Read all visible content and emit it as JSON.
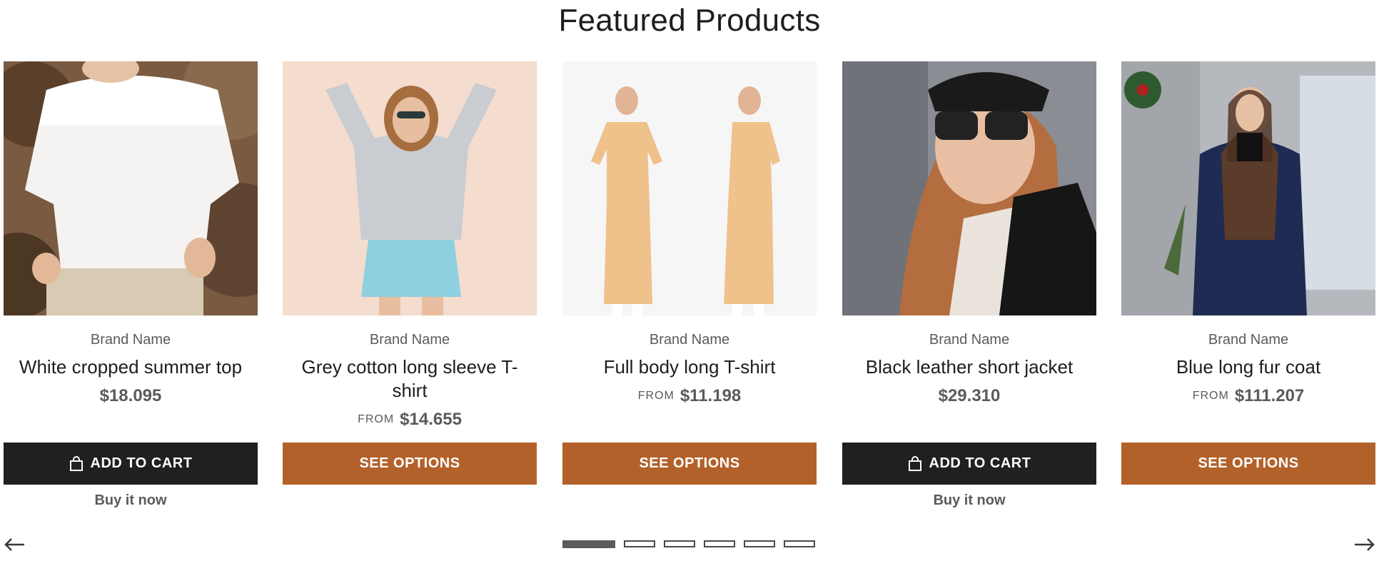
{
  "section": {
    "title": "Featured Products"
  },
  "products": [
    {
      "brand": "Brand Name",
      "name": "White cropped summer top",
      "from": "",
      "price": "$18.095",
      "button": "ADD TO CART",
      "buy_now": "Buy it now"
    },
    {
      "brand": "Brand Name",
      "name": "Grey cotton long sleeve T-shirt",
      "from": "FROM",
      "price": "$14.655",
      "button": "SEE OPTIONS",
      "buy_now": ""
    },
    {
      "brand": "Brand Name",
      "name": "Full body long T-shirt",
      "from": "FROM",
      "price": "$11.198",
      "button": "SEE OPTIONS",
      "buy_now": ""
    },
    {
      "brand": "Brand Name",
      "name": "Black leather short jacket",
      "from": "",
      "price": "$29.310",
      "button": "ADD TO CART",
      "buy_now": "Buy it now"
    },
    {
      "brand": "Brand Name",
      "name": "Blue long fur coat",
      "from": "FROM",
      "price": "$111.207",
      "button": "SEE OPTIONS",
      "buy_now": ""
    }
  ],
  "pagination": {
    "total": 6,
    "active": 1
  },
  "colors": {
    "dark_button": "#211f20",
    "accent_button": "#b3612a",
    "text_muted": "#5c5a5b"
  },
  "icons": {
    "add_to_cart": "shopping-bag-icon",
    "prev": "arrow-left-icon",
    "next": "arrow-right-icon"
  }
}
